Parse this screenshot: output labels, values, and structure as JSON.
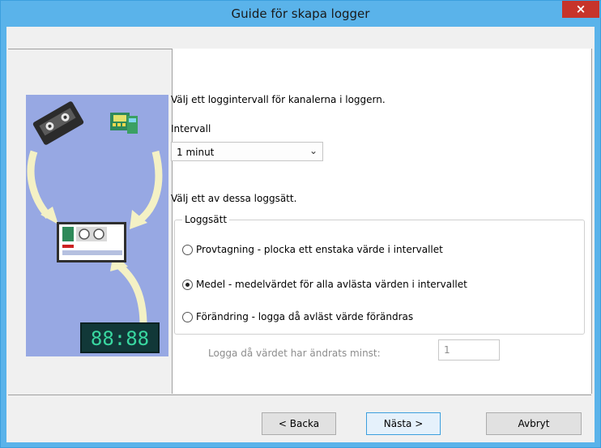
{
  "window": {
    "title": "Guide för skapa logger",
    "close_symbol": "×"
  },
  "content": {
    "intro": "Välj ett loggintervall för kanalerna i loggern.",
    "interval_label": "Intervall",
    "interval_value": "1 minut",
    "mode_intro": "Välj ett av dessa loggsätt.",
    "group_label": "Loggsätt",
    "options": [
      {
        "label": "Provtagning - plocka ett enstaka värde i intervallet",
        "checked": false
      },
      {
        "label": "Medel - medelvärdet för alla avlästa värden i intervallet",
        "checked": true
      },
      {
        "label": "Förändring - logga då avläst värde förändras",
        "checked": false
      }
    ],
    "change_label": "Logga då värdet har ändrats minst:",
    "change_value": "1"
  },
  "illustration": {
    "clock_text": "88:88",
    "icons": [
      "cassette-icon",
      "multimeter-icon",
      "recorder-icon",
      "digital-clock-icon"
    ]
  },
  "buttons": {
    "back": "< Backa",
    "next": "Nästa >",
    "cancel": "Avbryt"
  }
}
